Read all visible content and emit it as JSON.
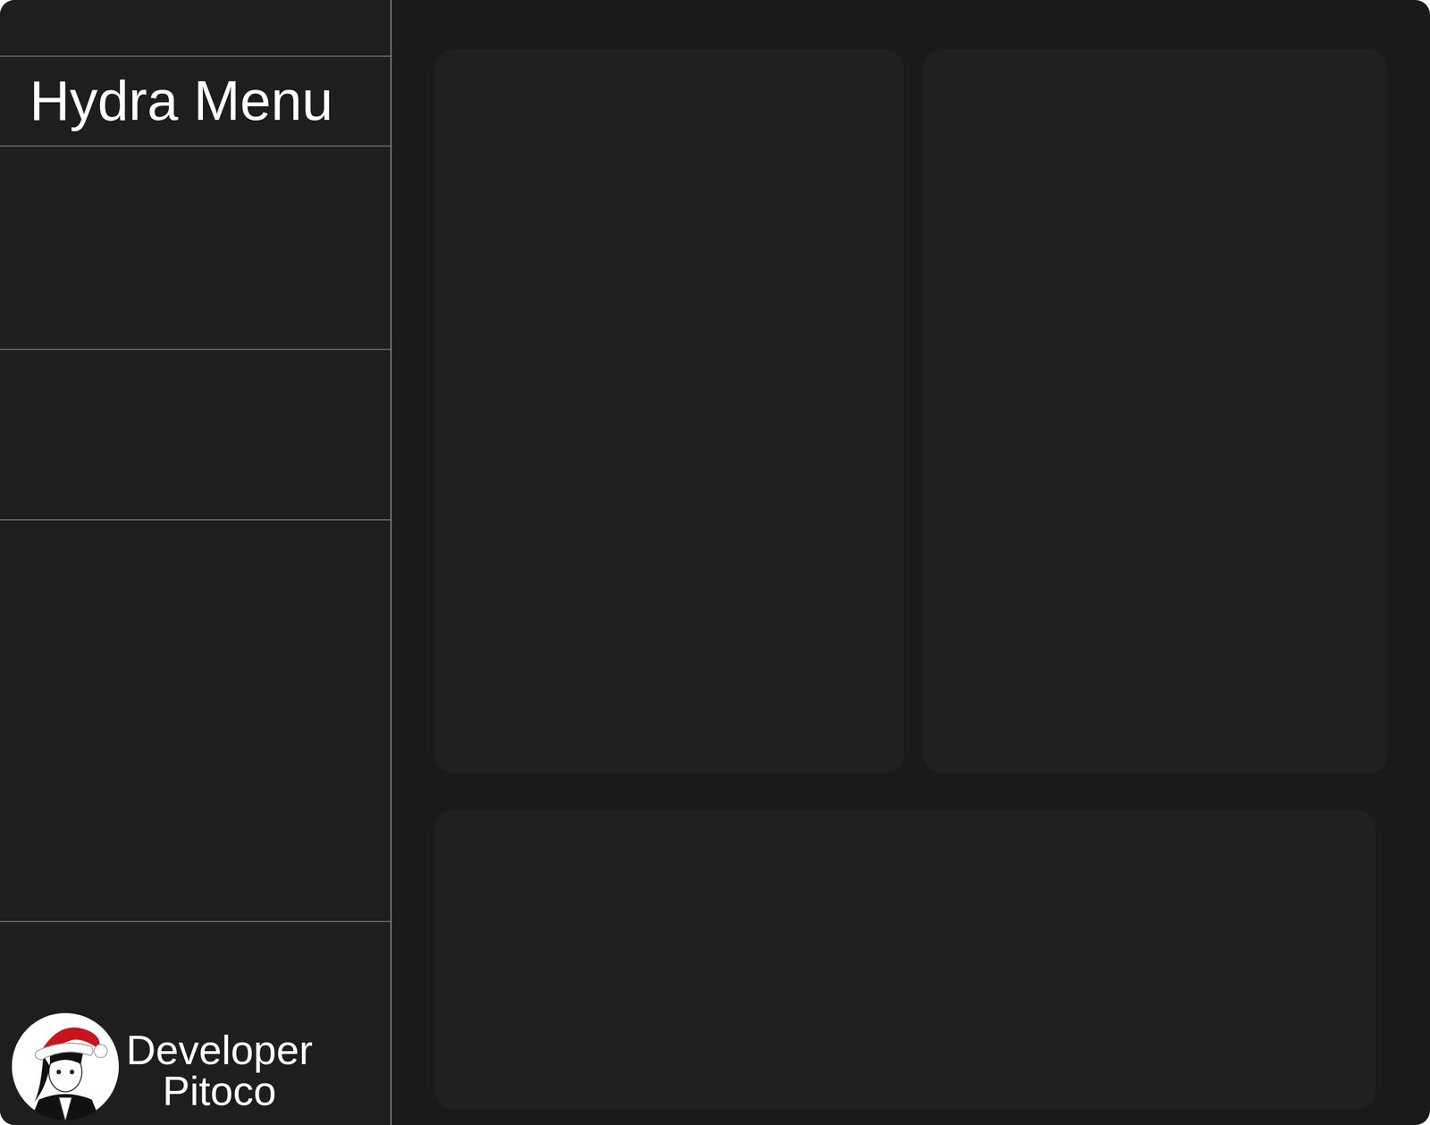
{
  "sidebar": {
    "title": "Hydra Menu",
    "footer": {
      "role": "Developer",
      "name": "Pitoco"
    }
  }
}
